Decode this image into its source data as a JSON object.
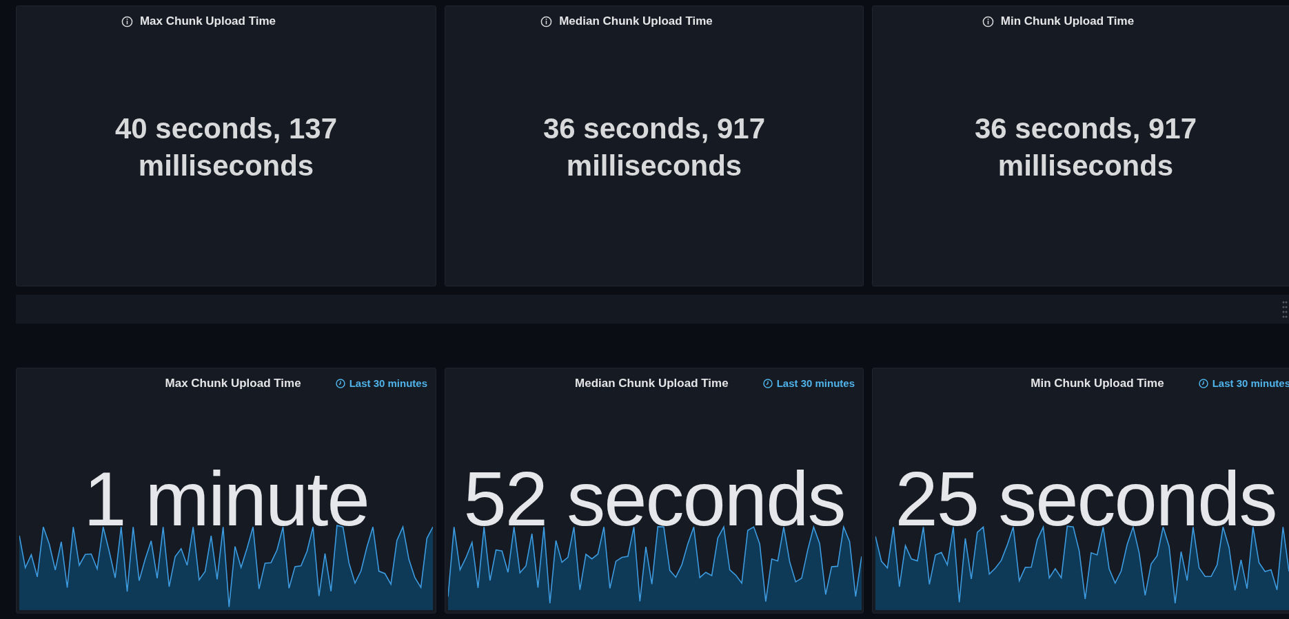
{
  "stat_panels": [
    {
      "title": "Max Chunk Upload Time",
      "value": "40 seconds, 137 milliseconds"
    },
    {
      "title": "Median Chunk Upload Time",
      "value": "36 seconds, 917 milliseconds"
    },
    {
      "title": "Min Chunk Upload Time",
      "value": "36 seconds, 917 milliseconds"
    }
  ],
  "trend_panels": [
    {
      "title": "Max Chunk Upload Time",
      "time_range": "Last 30 minutes",
      "value": "1 minute"
    },
    {
      "title": "Median Chunk Upload Time",
      "time_range": "Last 30 minutes",
      "value": "52 seconds"
    },
    {
      "title": "Min Chunk Upload Time",
      "time_range": "Last 30 minutes",
      "value": "25 seconds"
    }
  ]
}
